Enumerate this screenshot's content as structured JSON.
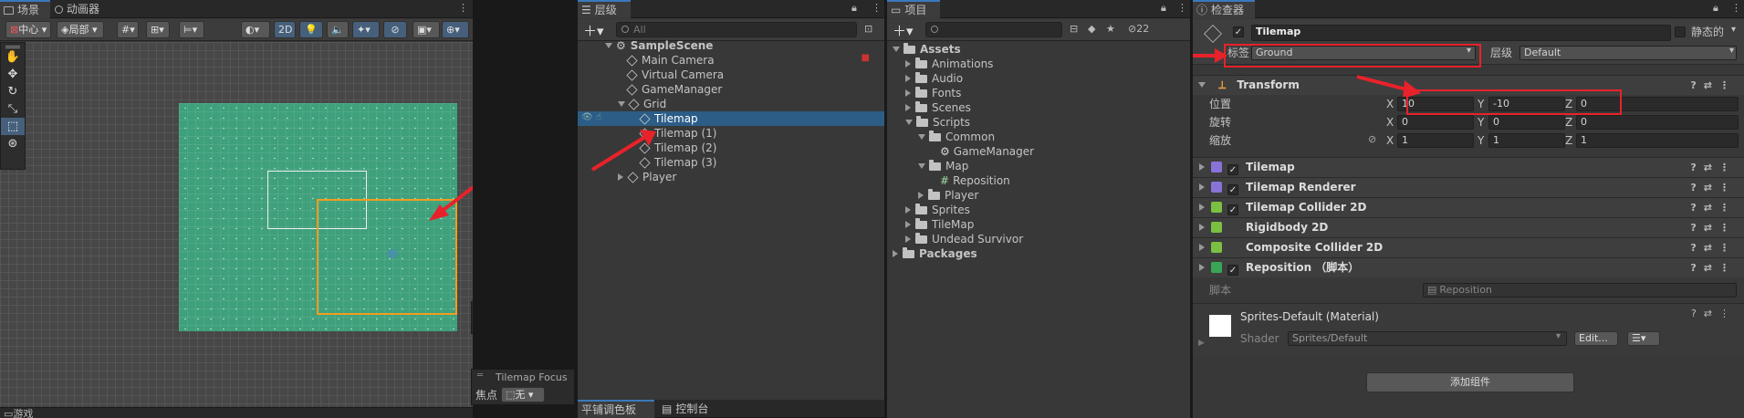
{
  "scene": {
    "tabs": [
      "场景",
      "动画器"
    ],
    "pivot_label": "中心",
    "space_label": "局部",
    "mode_2d": "2D",
    "focus_overlay_title": "Tilemap Focus",
    "focus_label": "焦点",
    "focus_value": "无"
  },
  "game_tab": "游戏",
  "hierarchy": {
    "tab": "层级",
    "search_placeholder": "All",
    "items": [
      {
        "label": "SampleScene",
        "indent": 0,
        "expand": "down",
        "icon": "unity-logo"
      },
      {
        "label": "Main Camera",
        "indent": 1,
        "expand": "none",
        "icon": "cube"
      },
      {
        "label": "Virtual Camera",
        "indent": 1,
        "expand": "none",
        "icon": "cube"
      },
      {
        "label": "GameManager",
        "indent": 1,
        "expand": "none",
        "icon": "cube"
      },
      {
        "label": "Grid",
        "indent": 1,
        "expand": "down",
        "icon": "cube"
      },
      {
        "label": "Tilemap",
        "indent": 2,
        "expand": "none",
        "icon": "cube",
        "selected": true
      },
      {
        "label": "Tilemap (1)",
        "indent": 2,
        "expand": "none",
        "icon": "cube"
      },
      {
        "label": "Tilemap (2)",
        "indent": 2,
        "expand": "none",
        "icon": "cube"
      },
      {
        "label": "Tilemap (3)",
        "indent": 2,
        "expand": "none",
        "icon": "cube"
      },
      {
        "label": "Player",
        "indent": 1,
        "expand": "right",
        "icon": "cube"
      }
    ],
    "bottom_tabs": [
      "平铺调色板",
      "控制台"
    ]
  },
  "project": {
    "tab": "项目",
    "hidden_count": "22",
    "items": [
      {
        "label": "Assets",
        "indent": 0,
        "expand": "down",
        "icon": "folder",
        "bold": true
      },
      {
        "label": "Animations",
        "indent": 1,
        "expand": "right",
        "icon": "folder"
      },
      {
        "label": "Audio",
        "indent": 1,
        "expand": "right",
        "icon": "folder"
      },
      {
        "label": "Fonts",
        "indent": 1,
        "expand": "right",
        "icon": "folder"
      },
      {
        "label": "Scenes",
        "indent": 1,
        "expand": "right",
        "icon": "folder"
      },
      {
        "label": "Scripts",
        "indent": 1,
        "expand": "down",
        "icon": "folder"
      },
      {
        "label": "Common",
        "indent": 2,
        "expand": "down",
        "icon": "folder"
      },
      {
        "label": "GameManager",
        "indent": 3,
        "expand": "none",
        "icon": "gear"
      },
      {
        "label": "Map",
        "indent": 2,
        "expand": "down",
        "icon": "folder"
      },
      {
        "label": "Reposition",
        "indent": 3,
        "expand": "none",
        "icon": "script"
      },
      {
        "label": "Player",
        "indent": 2,
        "expand": "right",
        "icon": "folder"
      },
      {
        "label": "Sprites",
        "indent": 1,
        "expand": "right",
        "icon": "folder"
      },
      {
        "label": "TileMap",
        "indent": 1,
        "expand": "right",
        "icon": "folder"
      },
      {
        "label": "Undead Survivor",
        "indent": 1,
        "expand": "right",
        "icon": "folder"
      },
      {
        "label": "Packages",
        "indent": 0,
        "expand": "right",
        "icon": "folder",
        "bold": true
      }
    ]
  },
  "inspector": {
    "tab": "检查器",
    "object_name": "Tilemap",
    "static_label": "静态的",
    "tag_label": "标签",
    "tag_value": "Ground",
    "layer_label": "层级",
    "layer_value": "Default",
    "transform": {
      "title": "Transform",
      "position_label": "位置",
      "rotation_label": "旋转",
      "scale_label": "缩放",
      "position": [
        "10",
        "-10",
        "0"
      ],
      "rotation": [
        "0",
        "0",
        "0"
      ],
      "scale": [
        "1",
        "1",
        "1"
      ],
      "axes": [
        "X",
        "Y",
        "Z"
      ]
    },
    "components": [
      {
        "label": "Tilemap",
        "has_check": true,
        "icon_color": "#8a73d8"
      },
      {
        "label": "Tilemap Renderer",
        "has_check": true,
        "icon_color": "#8a73d8"
      },
      {
        "label": "Tilemap Collider 2D",
        "has_check": true,
        "icon_color": "#7bc043"
      },
      {
        "label": "Rigidbody 2D",
        "has_check": false,
        "icon_color": "#7bc043"
      },
      {
        "label": "Composite Collider 2D",
        "has_check": false,
        "icon_color": "#7bc043"
      },
      {
        "label": "Reposition  （脚本）",
        "has_check": true,
        "icon_color": "#3aa655"
      }
    ],
    "script_label": "脚本",
    "script_value": "Reposition",
    "material_name": "Sprites-Default (Material)",
    "shader_label": "Shader",
    "shader_value": "Sprites/Default",
    "edit_button": "Edit...",
    "add_component_button": "添加组件"
  },
  "colors": {
    "accent": "#3a79bb",
    "selection": "#2c5d87",
    "tilemap_green": "#3fa07c",
    "highlight_orange": "#f29d1f",
    "annotation_red": "#e8222a"
  }
}
